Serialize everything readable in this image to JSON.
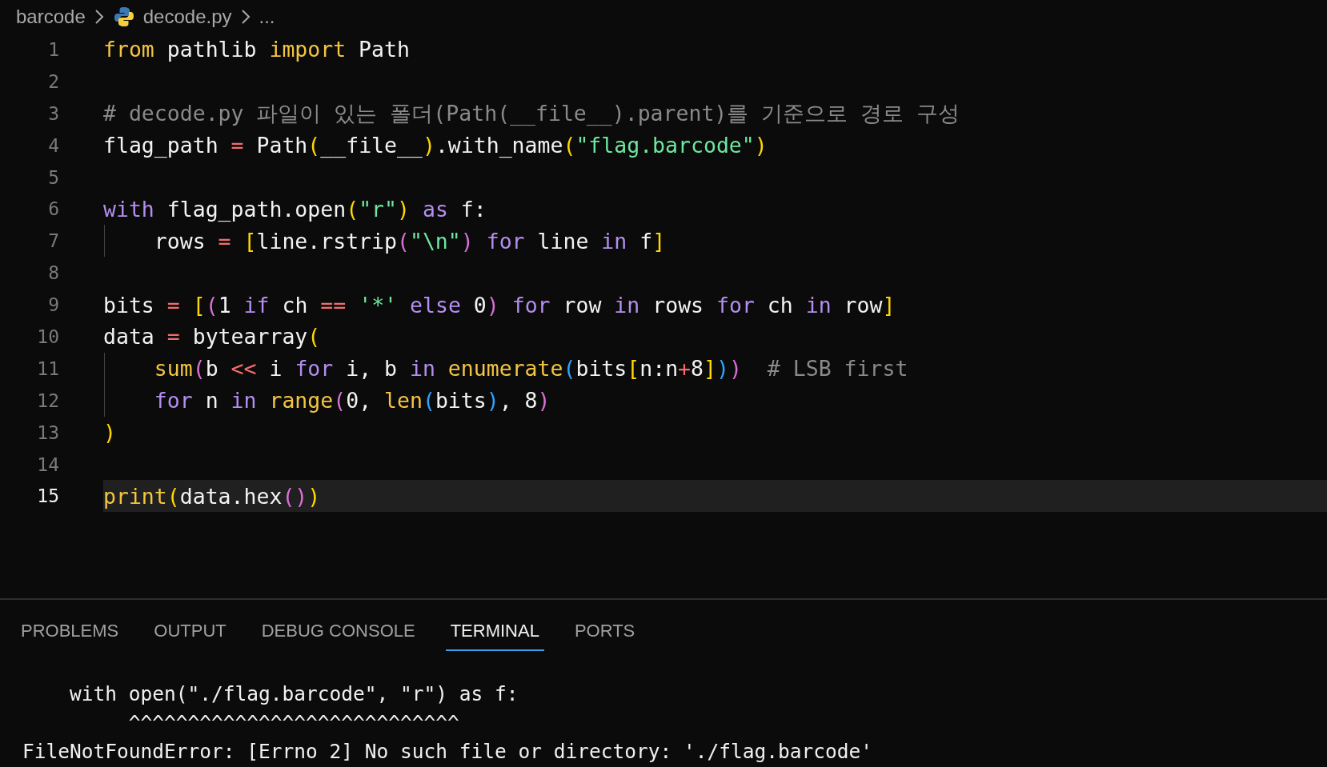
{
  "breadcrumb": {
    "folder": "barcode",
    "file": "decode.py",
    "more": "..."
  },
  "editor": {
    "lines": [
      {
        "number": "1",
        "selected": false,
        "indented": false,
        "tokens": [
          {
            "kind": "import",
            "text": "from"
          },
          {
            "kind": "text",
            "text": " pathlib "
          },
          {
            "kind": "import",
            "text": "import"
          },
          {
            "kind": "text",
            "text": " Path"
          }
        ]
      },
      {
        "number": "2",
        "selected": false,
        "indented": false
      },
      {
        "number": "3",
        "selected": false,
        "indented": false,
        "tokens": [
          {
            "kind": "comment",
            "text": "# decode.py 파일이 있는 폴더(Path(__file__).parent)를 기준으로 경로 구성"
          }
        ]
      },
      {
        "number": "4",
        "selected": false,
        "indented": false,
        "tokens": [
          {
            "kind": "text",
            "text": "flag_path "
          },
          {
            "kind": "op",
            "text": "="
          },
          {
            "kind": "text",
            "text": " Path"
          },
          {
            "kind": "b1",
            "text": "("
          },
          {
            "kind": "text",
            "text": "__file__"
          },
          {
            "kind": "b1",
            "text": ")"
          },
          {
            "kind": "text",
            "text": ".with_name"
          },
          {
            "kind": "b1",
            "text": "("
          },
          {
            "kind": "string",
            "text": "\"flag.barcode\""
          },
          {
            "kind": "b1",
            "text": ")"
          }
        ]
      },
      {
        "number": "5",
        "selected": false,
        "indented": false
      },
      {
        "number": "6",
        "selected": false,
        "indented": false,
        "tokens": [
          {
            "kind": "keyword",
            "text": "with"
          },
          {
            "kind": "text",
            "text": " flag_path.open"
          },
          {
            "kind": "b1",
            "text": "("
          },
          {
            "kind": "string",
            "text": "\"r\""
          },
          {
            "kind": "b1",
            "text": ")"
          },
          {
            "kind": "keyword",
            "text": " as"
          },
          {
            "kind": "text",
            "text": " f:"
          }
        ]
      },
      {
        "number": "7",
        "selected": false,
        "indented": true,
        "tokens": [
          {
            "kind": "text",
            "text": "rows "
          },
          {
            "kind": "op",
            "text": "= "
          },
          {
            "kind": "b1",
            "text": "["
          },
          {
            "kind": "text",
            "text": "line.rstrip"
          },
          {
            "kind": "b2",
            "text": "("
          },
          {
            "kind": "string",
            "text": "\"\\n\""
          },
          {
            "kind": "b2",
            "text": ")"
          },
          {
            "kind": "keyword",
            "text": " for"
          },
          {
            "kind": "text",
            "text": " line "
          },
          {
            "kind": "keyword",
            "text": "in"
          },
          {
            "kind": "text",
            "text": " f"
          },
          {
            "kind": "b1",
            "text": "]"
          }
        ]
      },
      {
        "number": "8",
        "selected": false,
        "indented": false
      },
      {
        "number": "9",
        "selected": false,
        "indented": false,
        "tokens": [
          {
            "kind": "text",
            "text": "bits "
          },
          {
            "kind": "op",
            "text": "= "
          },
          {
            "kind": "b1",
            "text": "["
          },
          {
            "kind": "b2",
            "text": "("
          },
          {
            "kind": "text",
            "text": "1 "
          },
          {
            "kind": "keyword",
            "text": "if"
          },
          {
            "kind": "text",
            "text": " ch "
          },
          {
            "kind": "op",
            "text": "== "
          },
          {
            "kind": "string",
            "text": "'*'"
          },
          {
            "kind": "keyword",
            "text": " else"
          },
          {
            "kind": "text",
            "text": " 0"
          },
          {
            "kind": "b2",
            "text": ")"
          },
          {
            "kind": "keyword",
            "text": " for"
          },
          {
            "kind": "text",
            "text": " row "
          },
          {
            "kind": "keyword",
            "text": "in"
          },
          {
            "kind": "text",
            "text": " rows "
          },
          {
            "kind": "keyword",
            "text": "for"
          },
          {
            "kind": "text",
            "text": " ch "
          },
          {
            "kind": "keyword",
            "text": "in"
          },
          {
            "kind": "text",
            "text": " row"
          },
          {
            "kind": "b1",
            "text": "]"
          }
        ]
      },
      {
        "number": "10",
        "selected": false,
        "indented": false,
        "tokens": [
          {
            "kind": "text",
            "text": "data "
          },
          {
            "kind": "op",
            "text": "="
          },
          {
            "kind": "text",
            "text": " bytearray"
          },
          {
            "kind": "b1",
            "text": "("
          }
        ]
      },
      {
        "number": "11",
        "selected": false,
        "indented": true,
        "tokens": [
          {
            "kind": "function",
            "text": "sum"
          },
          {
            "kind": "b2",
            "text": "("
          },
          {
            "kind": "text",
            "text": "b "
          },
          {
            "kind": "op",
            "text": "<<"
          },
          {
            "kind": "text",
            "text": " i "
          },
          {
            "kind": "keyword",
            "text": "for"
          },
          {
            "kind": "text",
            "text": " i, b "
          },
          {
            "kind": "keyword",
            "text": "in"
          },
          {
            "kind": "function",
            "text": " enumerate"
          },
          {
            "kind": "b3",
            "text": "("
          },
          {
            "kind": "text",
            "text": "bits"
          },
          {
            "kind": "b1",
            "text": "["
          },
          {
            "kind": "text",
            "text": "n:n"
          },
          {
            "kind": "op",
            "text": "+"
          },
          {
            "kind": "text",
            "text": "8"
          },
          {
            "kind": "b1",
            "text": "]"
          },
          {
            "kind": "b3",
            "text": ")"
          },
          {
            "kind": "b2",
            "text": ")"
          },
          {
            "kind": "comment",
            "text": "  # LSB first"
          }
        ]
      },
      {
        "number": "12",
        "selected": false,
        "indented": true,
        "tokens": [
          {
            "kind": "keyword",
            "text": "for"
          },
          {
            "kind": "text",
            "text": " n "
          },
          {
            "kind": "keyword",
            "text": "in"
          },
          {
            "kind": "function",
            "text": " range"
          },
          {
            "kind": "b2",
            "text": "("
          },
          {
            "kind": "text",
            "text": "0, "
          },
          {
            "kind": "function",
            "text": "len"
          },
          {
            "kind": "b3",
            "text": "("
          },
          {
            "kind": "text",
            "text": "bits"
          },
          {
            "kind": "b3",
            "text": ")"
          },
          {
            "kind": "text",
            "text": ", 8"
          },
          {
            "kind": "b2",
            "text": ")"
          }
        ]
      },
      {
        "number": "13",
        "selected": false,
        "indented": false,
        "tokens": [
          {
            "kind": "b1",
            "text": ")"
          }
        ]
      },
      {
        "number": "14",
        "selected": false,
        "indented": false
      },
      {
        "number": "15",
        "selected": true,
        "indented": false,
        "tokens": [
          {
            "kind": "function",
            "text": "print"
          },
          {
            "kind": "b1",
            "text": "("
          },
          {
            "kind": "text",
            "text": "data.hex"
          },
          {
            "kind": "b2",
            "text": "("
          },
          {
            "kind": "b2",
            "text": ")"
          },
          {
            "kind": "b1",
            "text": ")"
          }
        ]
      }
    ]
  },
  "panel": {
    "tabs": [
      {
        "label": "PROBLEMS",
        "selected": false
      },
      {
        "label": "OUTPUT",
        "selected": false
      },
      {
        "label": "DEBUG CONSOLE",
        "selected": false
      },
      {
        "label": "TERMINAL",
        "selected": true
      },
      {
        "label": "PORTS",
        "selected": false
      }
    ],
    "terminal_lines": [
      "    with open(\"./flag.barcode\", \"r\") as f:",
      "         ^^^^^^^^^^^^^^^^^^^^^^^^^^^^",
      "FileNotFoundError: [Errno 2] No such file or directory: './flag.barcode'"
    ]
  }
}
